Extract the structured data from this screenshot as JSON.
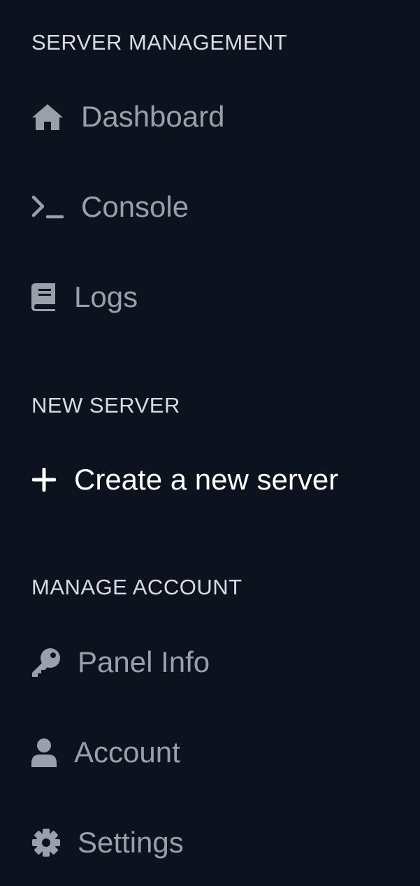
{
  "sections": [
    {
      "title": "SERVER MANAGEMENT",
      "items": [
        {
          "label": "Dashboard",
          "icon": "home-icon"
        },
        {
          "label": "Console",
          "icon": "terminal-icon"
        },
        {
          "label": "Logs",
          "icon": "book-icon"
        }
      ]
    },
    {
      "title": "NEW SERVER",
      "items": [
        {
          "label": "Create a new server",
          "icon": "plus-icon"
        }
      ]
    },
    {
      "title": "MANAGE ACCOUNT",
      "items": [
        {
          "label": "Panel Info",
          "icon": "key-icon"
        },
        {
          "label": "Account",
          "icon": "user-icon"
        },
        {
          "label": "Settings",
          "icon": "gear-icon"
        }
      ]
    }
  ],
  "colors": {
    "background": "#0d131e",
    "section_header": "#d7dbe2",
    "item_text": "#9aa0aa",
    "item_icon": "#9aa0aa",
    "highlight_text": "#ffffff"
  }
}
